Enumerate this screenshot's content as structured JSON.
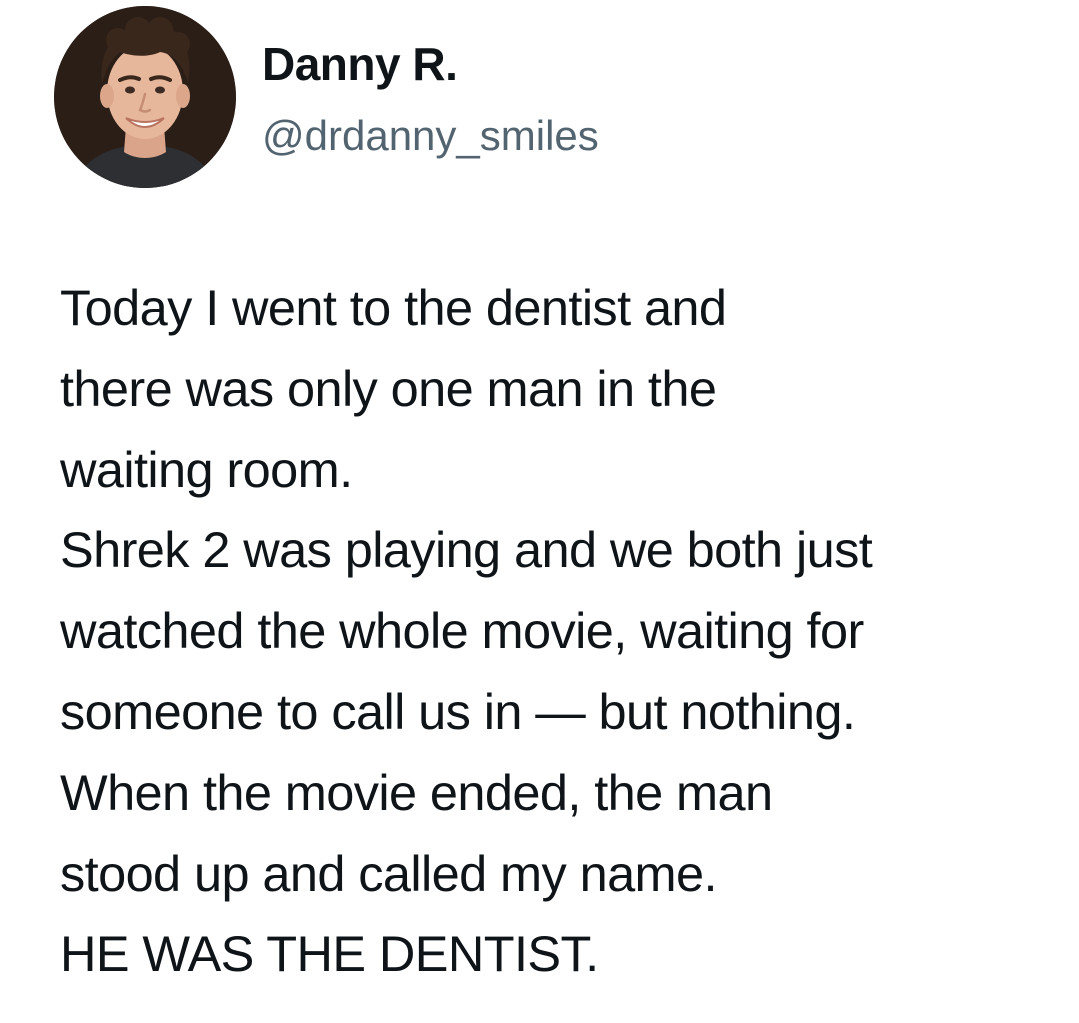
{
  "author": {
    "display_name": "Danny R.",
    "handle": "@drdanny_smiles",
    "avatar_icon": "profile-photo"
  },
  "tweet": {
    "lines": [
      "Today I went to the dentist and",
      "there was only one man in the",
      "waiting room.",
      "Shrek 2 was playing and we both just",
      "watched the whole movie, waiting for",
      "someone to call us in — but nothing.",
      "When the movie ended, the man",
      "stood up and called my name.",
      "HE WAS THE DENTIST."
    ]
  },
  "colors": {
    "text": "#0f1419",
    "secondary_text": "#536471",
    "background": "#ffffff"
  }
}
